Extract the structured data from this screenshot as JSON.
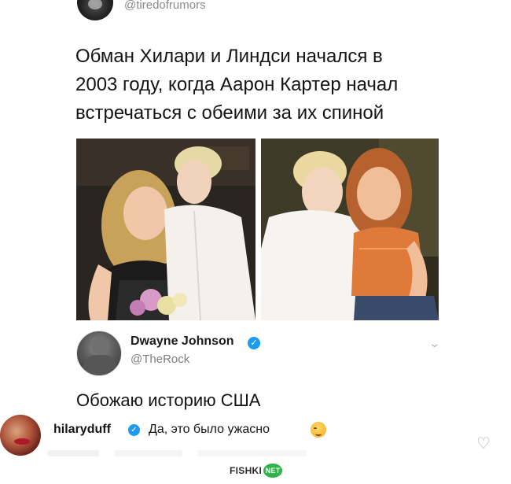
{
  "top_tweet": {
    "handle": "@tiredofrumors",
    "lines": [
      "Обман Хилари и Линдси начался в",
      "2003 году, когда Аарон Картер начал",
      "встречаться с обеими за их спиной"
    ]
  },
  "quoted_tweet": {
    "name": "Dwayne Johnson",
    "handle": "@TheRock",
    "text": "Обожаю историю США",
    "verified_glyph": "✓",
    "chevron_glyph": "⌄"
  },
  "comment": {
    "username": "hilaryduff",
    "text": "Да, это было ужасно",
    "verified_glyph": "✓",
    "heart_glyph": "♡",
    "emoji": "smirking-face"
  },
  "watermark": {
    "brand": "FISHKI",
    "badge": "NET"
  },
  "colors": {
    "verified": "#1d9bf0",
    "watermark_badge": "#2fb34a",
    "handle_gray": "#8a8a8a"
  }
}
